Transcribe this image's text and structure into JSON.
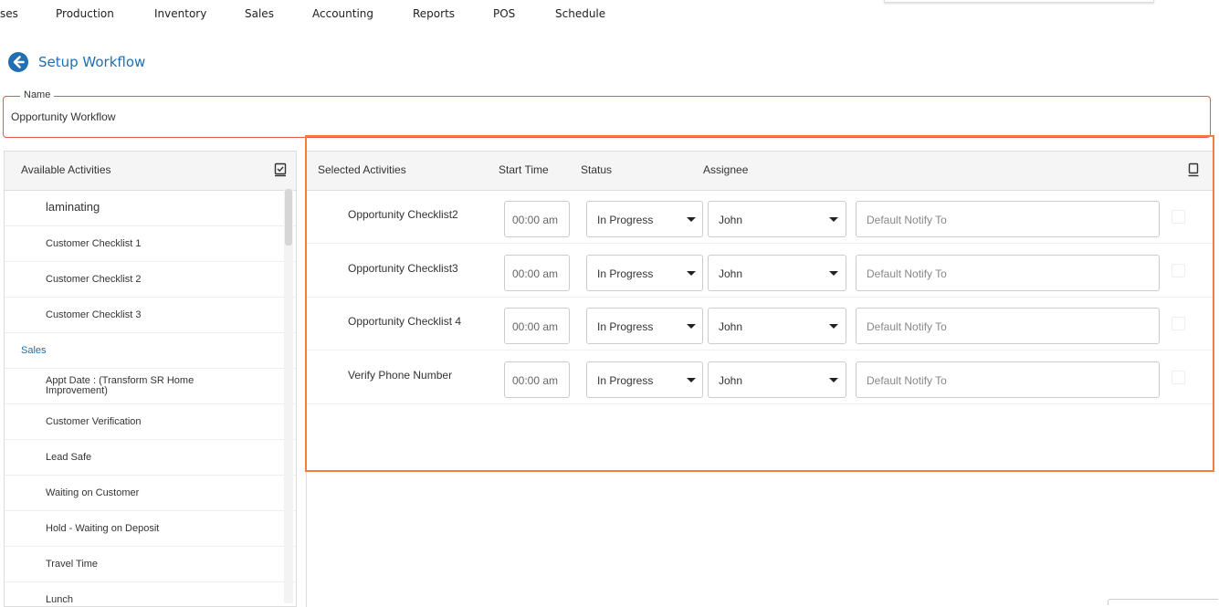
{
  "nav": {
    "items": [
      "ses",
      "Production",
      "Inventory",
      "Sales",
      "Accounting",
      "Reports",
      "POS",
      "Schedule"
    ]
  },
  "header": {
    "back_icon": "arrow-left-circle-icon",
    "title": "Setup Workflow"
  },
  "name_field": {
    "legend": "Name",
    "value": "Opportunity Workflow"
  },
  "available": {
    "title": "Available Activities",
    "header_icon": "checkbox-icon",
    "items": [
      {
        "label": "laminating",
        "kind": "big"
      },
      {
        "label": "Customer Checklist 1",
        "kind": "item"
      },
      {
        "label": "Customer Checklist 2",
        "kind": "item"
      },
      {
        "label": "Customer Checklist 3",
        "kind": "item"
      },
      {
        "label": "Sales",
        "kind": "group"
      },
      {
        "label": "Appt Date : (Transform SR Home Improvement)",
        "kind": "two"
      },
      {
        "label": "Customer Verification",
        "kind": "item"
      },
      {
        "label": "Lead Safe",
        "kind": "item"
      },
      {
        "label": "Waiting on Customer",
        "kind": "item"
      },
      {
        "label": "Hold - Waiting on Deposit",
        "kind": "item"
      },
      {
        "label": "Travel Time",
        "kind": "item"
      },
      {
        "label": "Lunch",
        "kind": "item"
      }
    ]
  },
  "selected": {
    "columns": {
      "activities": "Selected Activities",
      "start_time": "Start Time",
      "status": "Status",
      "assignee": "Assignee"
    },
    "header_icon": "checkbox-icon",
    "rows": [
      {
        "name": "Opportunity Checklist2",
        "time": "00:00 am",
        "status": "In Progress",
        "assignee": "John",
        "notify_placeholder": "Default Notify To"
      },
      {
        "name": "Opportunity Checklist3",
        "time": "00:00 am",
        "status": "In Progress",
        "assignee": "John",
        "notify_placeholder": "Default Notify To"
      },
      {
        "name": "Opportunity Checklist 4",
        "time": "00:00 am",
        "status": "In Progress",
        "assignee": "John",
        "notify_placeholder": "Default Notify To"
      },
      {
        "name": "Verify Phone Number",
        "time": "00:00 am",
        "status": "In Progress",
        "assignee": "John",
        "notify_placeholder": "Default Notify To"
      }
    ]
  },
  "colors": {
    "accent_blue": "#1f6fb2",
    "name_border": "#e8554e",
    "highlight": "#f07f3c"
  }
}
